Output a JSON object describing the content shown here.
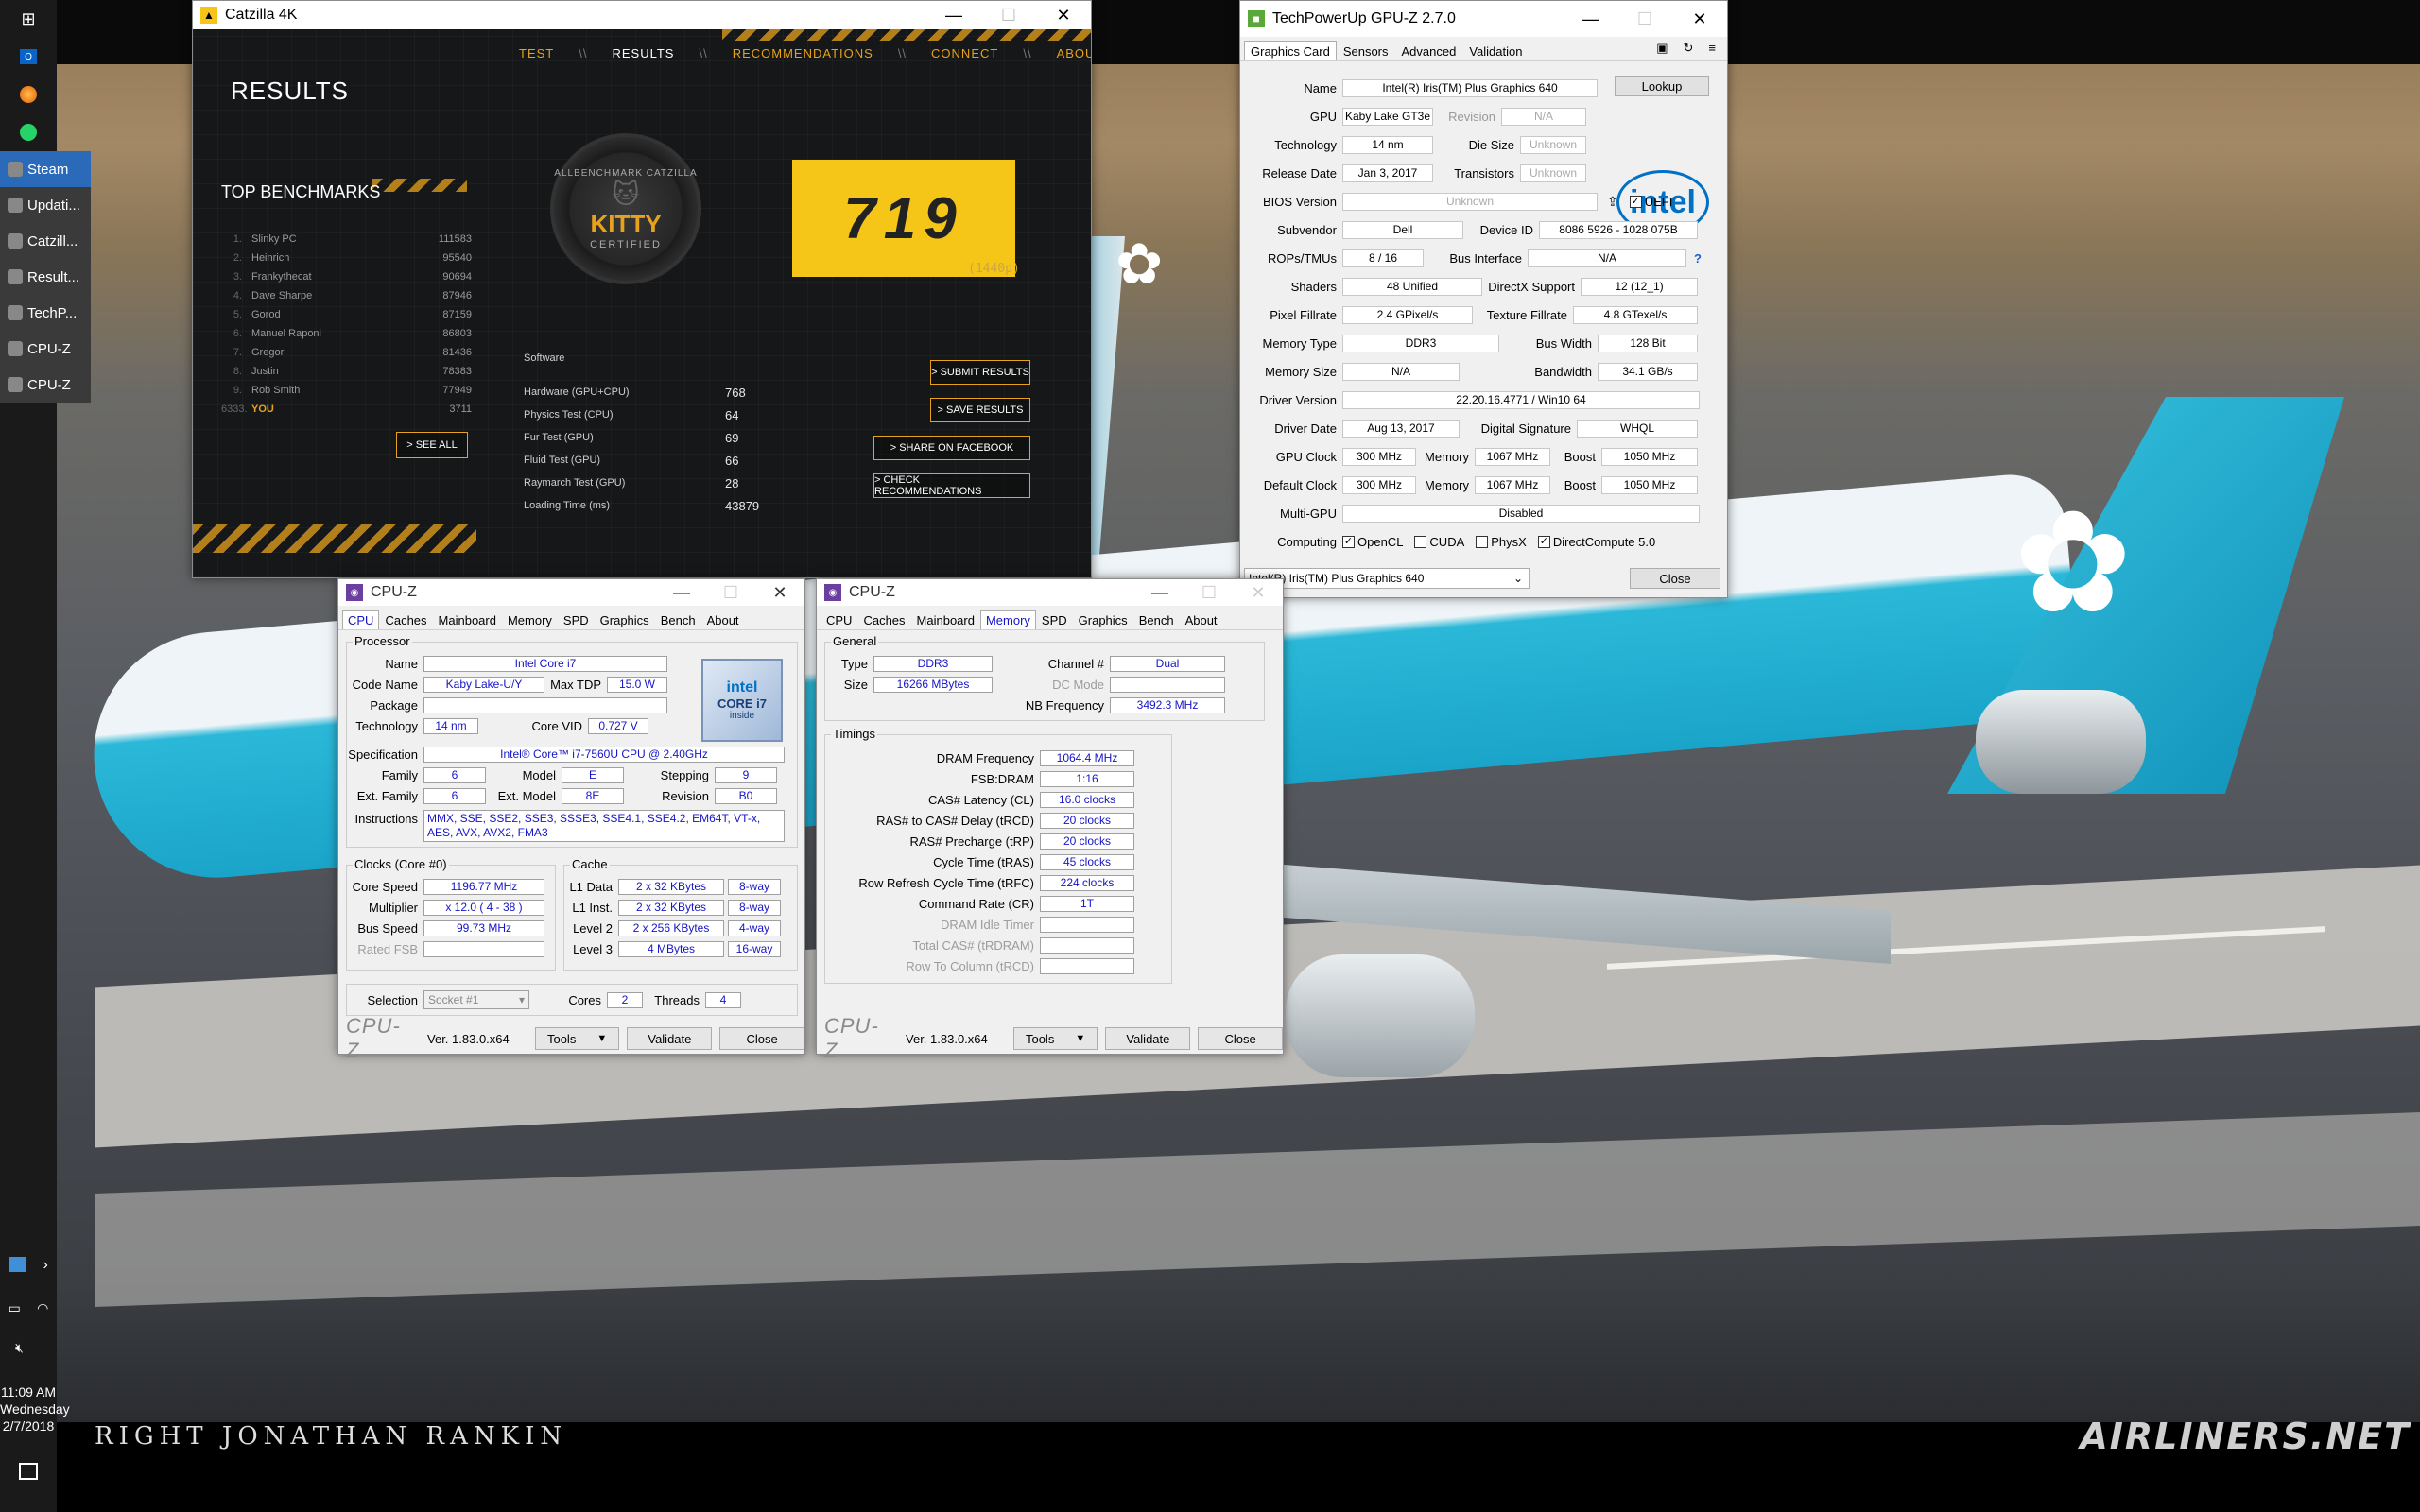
{
  "taskbar": {
    "apps": [
      {
        "label": "Steam",
        "color": "#2a6ab8"
      },
      {
        "label": "Updati...",
        "color": "#3a3a3a"
      },
      {
        "label": "Catzill...",
        "color": "#3a3a3a"
      },
      {
        "label": "Result...",
        "color": "#3a3a3a"
      },
      {
        "label": "TechP...",
        "color": "#3a3a3a"
      },
      {
        "label": "CPU-Z",
        "color": "#3a3a3a"
      },
      {
        "label": "CPU-Z",
        "color": "#3a3a3a"
      }
    ],
    "time": "11:09 AM",
    "day": "Wednesday",
    "date": "2/7/2018"
  },
  "wallpaper": {
    "copyright": "RIGHT JONATHAN RANKIN",
    "brand": "AIRLINERS.NET"
  },
  "catzilla": {
    "title": "Catzilla 4K",
    "nav": [
      "TEST",
      "RESULTS",
      "RECOMMENDATIONS",
      "CONNECT",
      "ABOUT"
    ],
    "heading": "RESULTS",
    "top_title": "TOP BENCHMARKS",
    "top": [
      {
        "rank": "1.",
        "name": "Slinky PC",
        "score": "111583"
      },
      {
        "rank": "2.",
        "name": "Heinrich",
        "score": "95540"
      },
      {
        "rank": "3.",
        "name": "Frankythecat",
        "score": "90694"
      },
      {
        "rank": "4.",
        "name": "Dave Sharpe",
        "score": "87946"
      },
      {
        "rank": "5.",
        "name": "Gorod",
        "score": "87159"
      },
      {
        "rank": "6.",
        "name": "Manuel Raponi",
        "score": "86803"
      },
      {
        "rank": "7.",
        "name": "Gregor",
        "score": "81436"
      },
      {
        "rank": "8.",
        "name": "Justin",
        "score": "78383"
      },
      {
        "rank": "9.",
        "name": "Rob Smith",
        "score": "77949"
      },
      {
        "rank": "6333.",
        "name": "YOU",
        "score": "3711"
      }
    ],
    "see_all": "> SEE ALL",
    "badge_top": "ALLBENCHMARK CATZILLA",
    "badge_mid": "KITTY",
    "badge_bottom": "CERTIFIED",
    "score": "719",
    "resolution": "(1440p)",
    "software_label": "Software",
    "stats": [
      {
        "label": "Hardware (GPU+CPU)",
        "value": "768"
      },
      {
        "label": "Physics Test (CPU)",
        "value": "64"
      },
      {
        "label": "Fur Test (GPU)",
        "value": "69"
      },
      {
        "label": "Fluid Test (GPU)",
        "value": "66"
      },
      {
        "label": "Raymarch Test (GPU)",
        "value": "28"
      },
      {
        "label": "Loading Time (ms)",
        "value": "43879"
      }
    ],
    "buttons": [
      "> SUBMIT RESULTS",
      "> SAVE RESULTS",
      "> SHARE ON FACEBOOK",
      "> CHECK RECOMMENDATIONS"
    ]
  },
  "gpuz": {
    "title": "TechPowerUp GPU-Z 2.7.0",
    "tabs": [
      "Graphics Card",
      "Sensors",
      "Advanced",
      "Validation"
    ],
    "name_label": "Name",
    "name": "Intel(R) Iris(TM) Plus Graphics 640",
    "lookup": "Lookup",
    "gpu_label": "GPU",
    "gpu": "Kaby Lake GT3e",
    "revision_label": "Revision",
    "revision": "N/A",
    "technology_label": "Technology",
    "technology": "14 nm",
    "die_label": "Die Size",
    "die": "Unknown",
    "release_label": "Release Date",
    "release": "Jan 3, 2017",
    "transistors_label": "Transistors",
    "transistors": "Unknown",
    "bios_label": "BIOS Version",
    "bios": "Unknown",
    "uefi": "UEFI",
    "subvendor_label": "Subvendor",
    "subvendor": "Dell",
    "device_label": "Device ID",
    "device": "8086 5926 - 1028 075B",
    "rops_label": "ROPs/TMUs",
    "rops": "8 / 16",
    "bus_label": "Bus Interface",
    "bus": "N/A",
    "help": "?",
    "shaders_label": "Shaders",
    "shaders": "48 Unified",
    "dx_label": "DirectX Support",
    "dx": "12 (12_1)",
    "pixel_label": "Pixel Fillrate",
    "pixel": "2.4 GPixel/s",
    "texture_label": "Texture Fillrate",
    "texture": "4.8 GTexel/s",
    "memtype_label": "Memory Type",
    "memtype": "DDR3",
    "buswidth_label": "Bus Width",
    "buswidth": "128 Bit",
    "memsize_label": "Memory Size",
    "memsize": "N/A",
    "bandwidth_label": "Bandwidth",
    "bandwidth": "34.1 GB/s",
    "driverver_label": "Driver Version",
    "driverver": "22.20.16.4771 / Win10 64",
    "driverdate_label": "Driver Date",
    "driverdate": "Aug 13, 2017",
    "sig_label": "Digital Signature",
    "sig": "WHQL",
    "gpuclock_label": "GPU Clock",
    "gpuclock": "300 MHz",
    "memory_label": "Memory",
    "gpumem": "1067 MHz",
    "boost_label": "Boost",
    "gpuboost": "1050 MHz",
    "defclock_label": "Default Clock",
    "defclock": "300 MHz",
    "defmem": "1067 MHz",
    "defboost": "1050 MHz",
    "multigpu_label": "Multi-GPU",
    "multigpu": "Disabled",
    "computing_label": "Computing",
    "compute": [
      {
        "label": "OpenCL",
        "checked": true
      },
      {
        "label": "CUDA",
        "checked": false
      },
      {
        "label": "PhysX",
        "checked": false
      },
      {
        "label": "DirectCompute 5.0",
        "checked": true
      }
    ],
    "select": "Intel(R) Iris(TM) Plus Graphics 640",
    "close": "Close",
    "logo": "intel"
  },
  "cpuz1": {
    "title": "CPU-Z",
    "tabs": [
      "CPU",
      "Caches",
      "Mainboard",
      "Memory",
      "SPD",
      "Graphics",
      "Bench",
      "About"
    ],
    "processor": "Processor",
    "name_label": "Name",
    "name": "Intel Core i7",
    "codename_label": "Code Name",
    "codename": "Kaby Lake-U/Y",
    "tdp_label": "Max TDP",
    "tdp": "15.0 W",
    "package_label": "Package",
    "package": "",
    "tech_label": "Technology",
    "tech": "14 nm",
    "vid_label": "Core VID",
    "vid": "0.727 V",
    "spec_label": "Specification",
    "spec": "Intel® Core™ i7-7560U CPU @ 2.40GHz",
    "family_label": "Family",
    "family": "6",
    "model_label": "Model",
    "model": "E",
    "stepping_label": "Stepping",
    "stepping": "9",
    "extfamily_label": "Ext. Family",
    "extfamily": "6",
    "extmodel_label": "Ext. Model",
    "extmodel": "8E",
    "revision_label": "Revision",
    "revision": "B0",
    "instr_label": "Instructions",
    "instr": "MMX, SSE, SSE2, SSE3, SSSE3, SSE4.1, SSE4.2, EM64T, VT-x, AES, AVX, AVX2, FMA3",
    "clocks": "Clocks (Core #0)",
    "corespeed_label": "Core Speed",
    "corespeed": "1196.77 MHz",
    "mult_label": "Multiplier",
    "mult": "x 12.0 ( 4 - 38 )",
    "busspeed_label": "Bus Speed",
    "busspeed": "99.73 MHz",
    "ratedfsb_label": "Rated FSB",
    "cache": "Cache",
    "l1d_label": "L1 Data",
    "l1d": "2 x 32 KBytes",
    "l1d_way": "8-way",
    "l1i_label": "L1 Inst.",
    "l1i": "2 x 32 KBytes",
    "l1i_way": "8-way",
    "l2_label": "Level 2",
    "l2": "2 x 256 KBytes",
    "l2_way": "4-way",
    "l3_label": "Level 3",
    "l3": "4 MBytes",
    "l3_way": "16-way",
    "selection_label": "Selection",
    "selection": "Socket #1",
    "cores_label": "Cores",
    "cores": "2",
    "threads_label": "Threads",
    "threads": "4",
    "chip_top": "intel",
    "chip_mid": "CORE i7",
    "chip_bot": "inside"
  },
  "cpuz2": {
    "title": "CPU-Z",
    "tabs": [
      "CPU",
      "Caches",
      "Mainboard",
      "Memory",
      "SPD",
      "Graphics",
      "Bench",
      "About"
    ],
    "general": "General",
    "type_label": "Type",
    "type": "DDR3",
    "channel_label": "Channel #",
    "channel": "Dual",
    "size_label": "Size",
    "size": "16266 MBytes",
    "dcmode_label": "DC Mode",
    "nbfreq_label": "NB Frequency",
    "nbfreq": "3492.3 MHz",
    "timings": "Timings",
    "rows": [
      {
        "label": "DRAM Frequency",
        "value": "1064.4 MHz",
        "dim": false
      },
      {
        "label": "FSB:DRAM",
        "value": "1:16",
        "dim": false
      },
      {
        "label": "CAS# Latency (CL)",
        "value": "16.0 clocks",
        "dim": false
      },
      {
        "label": "RAS# to CAS# Delay (tRCD)",
        "value": "20 clocks",
        "dim": false
      },
      {
        "label": "RAS# Precharge (tRP)",
        "value": "20 clocks",
        "dim": false
      },
      {
        "label": "Cycle Time (tRAS)",
        "value": "45 clocks",
        "dim": false
      },
      {
        "label": "Row Refresh Cycle Time (tRFC)",
        "value": "224 clocks",
        "dim": false
      },
      {
        "label": "Command Rate (CR)",
        "value": "1T",
        "dim": false
      },
      {
        "label": "DRAM Idle Timer",
        "value": "",
        "dim": true
      },
      {
        "label": "Total CAS# (tRDRAM)",
        "value": "",
        "dim": true
      },
      {
        "label": "Row To Column (tRCD)",
        "value": "",
        "dim": true
      }
    ]
  },
  "cpuz_footer": {
    "brand": "CPU-Z",
    "version": "Ver. 1.83.0.x64",
    "tools": "Tools",
    "validate": "Validate",
    "close": "Close"
  }
}
